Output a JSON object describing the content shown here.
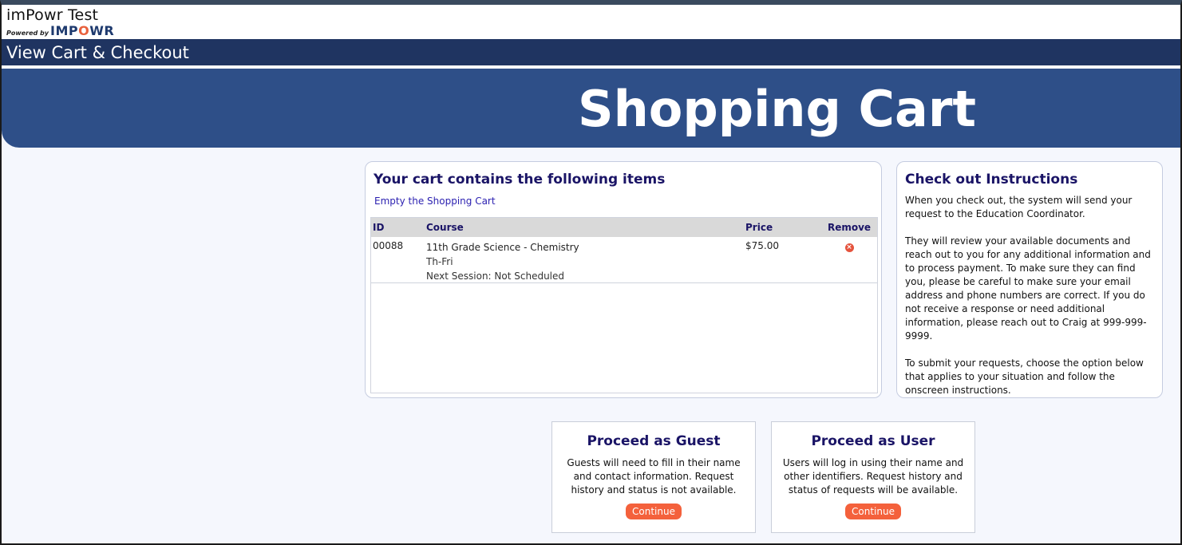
{
  "brand": {
    "title": "imPowr Test",
    "powered_by": "Powered by",
    "logo_pre": "IMP",
    "logo_o": "O",
    "logo_post": "WR"
  },
  "header": {
    "title": "View Cart & Checkout"
  },
  "hero": {
    "title": "Shopping Cart"
  },
  "cart": {
    "heading": "Your cart contains the following items",
    "empty_link": "Empty the Shopping Cart",
    "columns": {
      "id": "ID",
      "course": "Course",
      "price": "Price",
      "remove": "Remove"
    },
    "items": [
      {
        "id": "00088",
        "course": "11th Grade Science - Chemistry",
        "schedule": "Th-Fri",
        "next_session": "Next Session: Not Scheduled",
        "price": "$75.00"
      }
    ]
  },
  "instructions": {
    "heading": "Check out Instructions",
    "paragraphs": [
      "When you check out, the system will send your request to the Education Coordinator.",
      "They will review your available documents and reach out to you for any additional information and to process payment. To make sure they can find you, please be careful to make sure your email address and phone numbers are correct. If you do not receive a response or need additional information, please reach out to Craig at 999-999-9999.",
      "To submit your requests, choose the option below that applies to your situation and follow the onscreen instructions."
    ]
  },
  "guest": {
    "title": "Proceed as Guest",
    "description": "Guests will need to fill in their name and contact information. Request history and status is not available.",
    "button": "Continue"
  },
  "user": {
    "title": "Proceed as User",
    "description": "Users will log in using their name and other identifiers. Request history and status of requests will be available.",
    "button": "Continue"
  },
  "colors": {
    "header_bg": "#1f3461",
    "hero_bg": "#2e4f88",
    "heading_text": "#1a1466",
    "accent_button": "#f4613c",
    "remove_icon": "#e5533d"
  }
}
